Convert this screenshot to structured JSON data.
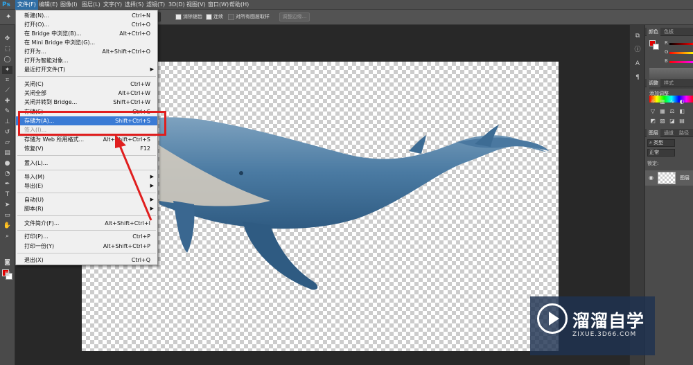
{
  "app": {
    "logo": "Ps"
  },
  "menubar": {
    "items": [
      "文件(F)",
      "编辑(E)",
      "图像(I)",
      "图层(L)",
      "文字(Y)",
      "选择(S)",
      "滤镜(T)",
      "3D(D)",
      "视图(V)",
      "窗口(W)",
      "帮助(H)"
    ]
  },
  "options_bar": {
    "anti_alias": "消除锯齿",
    "contiguous": "连续",
    "sample_all_layers": "对所有图层取样",
    "refine_edge": "调整边缘..."
  },
  "file_menu": {
    "items": [
      {
        "label": "新建(N)...",
        "shortcut": "Ctrl+N"
      },
      {
        "label": "打开(O)...",
        "shortcut": "Ctrl+O"
      },
      {
        "label": "在 Bridge 中浏览(B)...",
        "shortcut": "Alt+Ctrl+O"
      },
      {
        "label": "在 Mini Bridge 中浏览(G)...",
        "shortcut": ""
      },
      {
        "label": "打开为...",
        "shortcut": "Alt+Shift+Ctrl+O"
      },
      {
        "label": "打开为智能对象...",
        "shortcut": ""
      },
      {
        "label": "最近打开文件(T)",
        "shortcut": ""
      },
      {
        "label": "关闭(C)",
        "shortcut": "Ctrl+W"
      },
      {
        "label": "关闭全部",
        "shortcut": "Alt+Ctrl+W"
      },
      {
        "label": "关闭并转到 Bridge...",
        "shortcut": "Shift+Ctrl+W"
      },
      {
        "label": "存储(S)",
        "shortcut": "Ctrl+S"
      },
      {
        "label": "存储为(A)...",
        "shortcut": "Shift+Ctrl+S"
      },
      {
        "label": "签入(I)...",
        "shortcut": ""
      },
      {
        "label": "存储为 Web 所用格式...",
        "shortcut": "Alt+Shift+Ctrl+S"
      },
      {
        "label": "恢复(V)",
        "shortcut": "F12"
      },
      {
        "label": "置入(L)...",
        "shortcut": ""
      },
      {
        "label": "导入(M)",
        "shortcut": ""
      },
      {
        "label": "导出(E)",
        "shortcut": ""
      },
      {
        "label": "自动(U)",
        "shortcut": ""
      },
      {
        "label": "脚本(R)",
        "shortcut": ""
      },
      {
        "label": "文件简介(F)...",
        "shortcut": "Alt+Shift+Ctrl+I"
      },
      {
        "label": "打印(P)...",
        "shortcut": "Ctrl+P"
      },
      {
        "label": "打印一份(Y)",
        "shortcut": "Alt+Shift+Ctrl+P"
      },
      {
        "label": "退出(X)",
        "shortcut": "Ctrl+Q"
      }
    ]
  },
  "panels": {
    "color_tabs": [
      "颜色",
      "色板"
    ],
    "sliders": [
      "R",
      "G",
      "B"
    ],
    "adjust_tabs": [
      "调整",
      "样式"
    ],
    "adjust_title": "添加调整",
    "layers_tabs": [
      "图层",
      "通道",
      "路径"
    ],
    "filter_kind": "类型",
    "blend_mode": "正常",
    "lock_label": "锁定:",
    "layer_name": "图层"
  },
  "watermark": {
    "title": "溜溜自学",
    "url": "ZIXUE.3D66.COM"
  },
  "colors": {
    "foreground": "#e00000",
    "background": "#ffffff",
    "highlight": "#3a7bd5",
    "annotation": "#e01e1e"
  }
}
